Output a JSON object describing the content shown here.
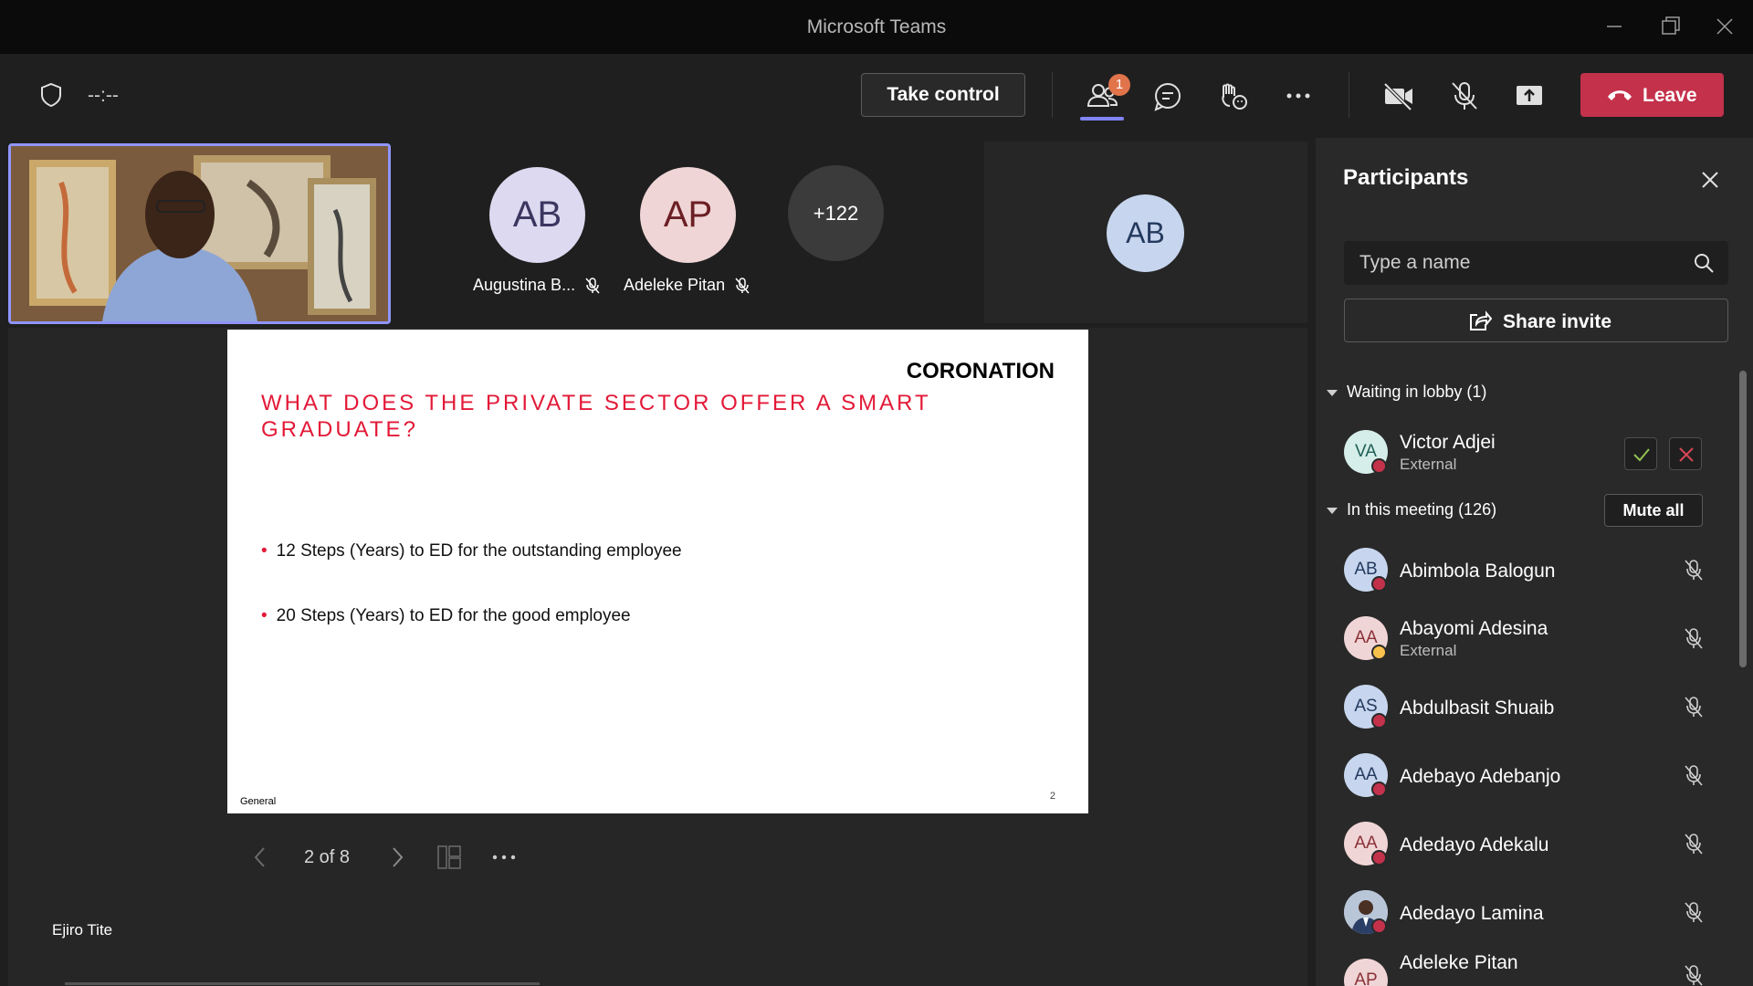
{
  "window": {
    "title": "Microsoft Teams"
  },
  "meeting_bar": {
    "timer": "--:--",
    "take_control_label": "Take control",
    "participants_badge": "1",
    "leave_label": "Leave"
  },
  "strip": {
    "tiles": [
      {
        "initials": "AB",
        "name": "Augustina B..."
      },
      {
        "initials": "AP",
        "name": "Adeleke Pitan"
      }
    ],
    "overflow_label": "+122",
    "right_tile_initials": "AB"
  },
  "slide": {
    "brand": "CORONATION",
    "heading": "WHAT DOES THE PRIVATE SECTOR OFFER A SMART GRADUATE?",
    "bullets": [
      "12 Steps (Years) to ED for the outstanding employee",
      "20 Steps (Years) to ED for the good employee"
    ],
    "footer": "General",
    "page_number": "2"
  },
  "slide_nav": {
    "counter": "2 of 8"
  },
  "presenter": {
    "name": "Ejiro Tite"
  },
  "panel": {
    "title": "Participants",
    "search_placeholder": "Type a name",
    "share_invite_label": "Share invite",
    "lobby_header": "Waiting in lobby (1)",
    "lobby": [
      {
        "initials": "VA",
        "name": "Victor Adjei",
        "sub": "External"
      }
    ],
    "meeting_header": "In this meeting (126)",
    "mute_all_label": "Mute all",
    "participants": [
      {
        "initials": "AB",
        "name": "Abimbola Balogun",
        "sub": ""
      },
      {
        "initials": "AA",
        "name": "Abayomi Adesina",
        "sub": "External"
      },
      {
        "initials": "AS",
        "name": "Abdulbasit Shuaib",
        "sub": ""
      },
      {
        "initials": "AA",
        "name": "Adebayo Adebanjo",
        "sub": ""
      },
      {
        "initials": "AA",
        "name": "Adedayo Adekalu",
        "sub": ""
      },
      {
        "initials": "",
        "name": "Adedayo Lamina",
        "sub": ""
      },
      {
        "initials": "AP",
        "name": "Adeleke Pitan",
        "sub": ""
      }
    ]
  },
  "colors": {
    "leave": "#c4314b",
    "accent": "#7f85f5",
    "slide_red": "#e31937",
    "status_busy": "#c4314b",
    "status_away": "#f8c14b"
  }
}
